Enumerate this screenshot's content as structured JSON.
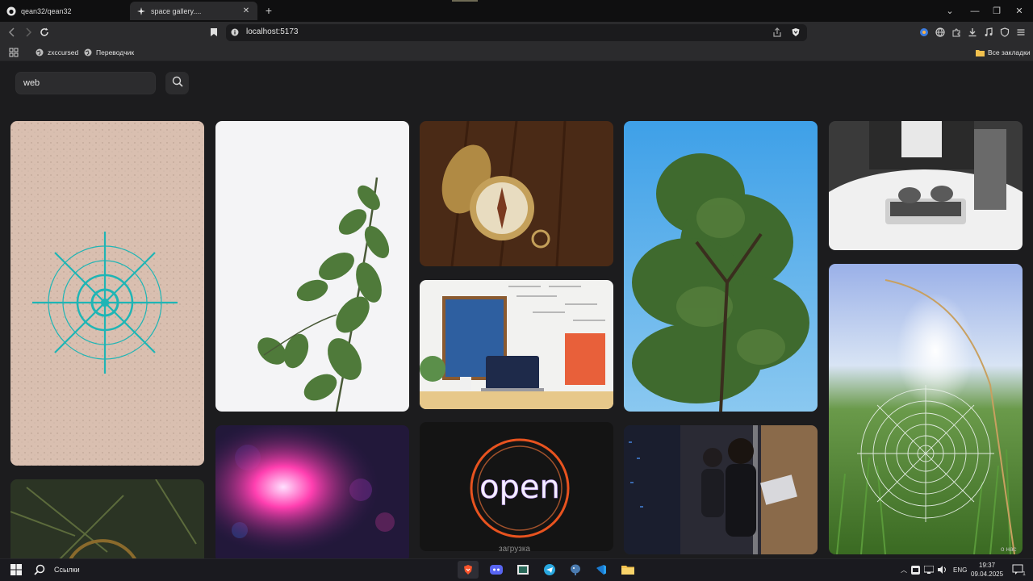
{
  "browser": {
    "tabs": [
      {
        "title": "qean32/qean32",
        "icon": "github-icon"
      },
      {
        "title": "space gallery....",
        "icon": "sparkle-icon",
        "active": true
      }
    ],
    "url": "localhost:5173",
    "bookmarks": [
      {
        "label": "zxccursed",
        "icon": "globe-icon"
      },
      {
        "label": "Переводчик",
        "icon": "globe-icon"
      }
    ],
    "all_bookmarks": "Все закладки"
  },
  "search": {
    "value": "web",
    "button_icon": "search-icon"
  },
  "gallery": {
    "loading_text": "загрузка",
    "neon_sign_text": "open",
    "corner_label": "о нас",
    "photos": [
      "spider-web-rope-on-sand",
      "eucalyptus-leaves",
      "compass-on-wood",
      "laptop-desk-whiteboard",
      "tree-blue-sky",
      "typing-laptop-bw",
      "spider-web-in-grass",
      "grass-closeup",
      "pink-bokeh-light",
      "neon-open-sign",
      "woman-with-laptop-server-room"
    ]
  },
  "taskbar": {
    "search_label": "Ссылки",
    "lang": "ENG",
    "time": "19:37",
    "date": "09.04.2025",
    "notification_count": "1"
  },
  "colors": {
    "page_bg": "#1c1c1e",
    "chrome_bg": "#2b2b2d",
    "taskbar_bg": "#1a1a1f"
  }
}
